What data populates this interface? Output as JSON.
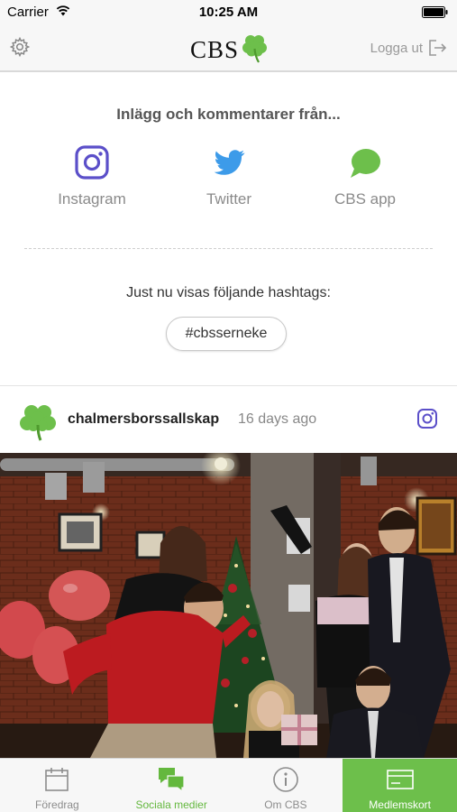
{
  "status_bar": {
    "carrier": "Carrier",
    "time": "10:25 AM"
  },
  "nav": {
    "logo_text": "CBS",
    "logout_label": "Logga ut"
  },
  "sources": {
    "title": "Inlägg och kommentarer från...",
    "items": [
      {
        "label": "Instagram",
        "icon": "instagram-icon"
      },
      {
        "label": "Twitter",
        "icon": "twitter-bird-icon"
      },
      {
        "label": "CBS app",
        "icon": "chat-bubble-icon"
      }
    ]
  },
  "hashtags": {
    "title": "Just nu visas följande hashtags:",
    "tag": "#cbsserneke"
  },
  "post": {
    "author": "chalmersborssallskap",
    "time": "16 days ago",
    "source_icon": "instagram-icon"
  },
  "tabs": [
    {
      "label": "Föredrag",
      "icon": "calendar-icon"
    },
    {
      "label": "Sociala medier",
      "icon": "chat-bubbles-icon"
    },
    {
      "label": "Om CBS",
      "icon": "info-icon"
    },
    {
      "label": "Medlemskort",
      "icon": "card-icon"
    }
  ],
  "colors": {
    "brand_green": "#6dbf4b",
    "instagram_purple": "#5b4fc9",
    "twitter_blue": "#3d9be9"
  }
}
